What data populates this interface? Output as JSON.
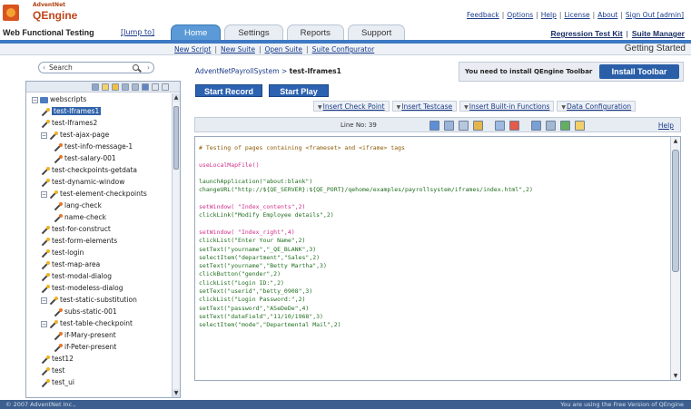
{
  "header": {
    "vendor": "AdventNet",
    "product": "QEngine",
    "app_title": "Web Functional Testing",
    "jump_to": "[Jump to]",
    "top_links": [
      "Feedback",
      "Options",
      "Help",
      "License",
      "About",
      "Sign Out [admin]"
    ],
    "right_links": [
      "Regression Test Kit",
      "Suite Manager"
    ],
    "tabs": [
      {
        "label": "Home",
        "active": true
      },
      {
        "label": "Settings",
        "active": false
      },
      {
        "label": "Reports",
        "active": false
      },
      {
        "label": "Support",
        "active": false
      }
    ]
  },
  "subnav": {
    "links": [
      "New Script",
      "New Suite",
      "Open Suite",
      "Suite Configurator"
    ],
    "getting_started": "Getting Started"
  },
  "left_panel": {
    "search_label": "Search",
    "tree": [
      {
        "label": "webscripts",
        "icon": "folder-icon",
        "expander": "−",
        "level": 0
      },
      {
        "label": "test-Iframes1",
        "icon": "wand-icon",
        "level": 1,
        "selected": true
      },
      {
        "label": "test-Iframes2",
        "icon": "wand-icon",
        "level": 1
      },
      {
        "label": "test-ajax-page",
        "icon": "wand-icon",
        "expander": "−",
        "level": 1
      },
      {
        "label": "test-info-message-1",
        "icon": "wand-icon",
        "level": 2,
        "orange": true
      },
      {
        "label": "test-salary-001",
        "icon": "wand-icon",
        "level": 2,
        "orange": true
      },
      {
        "label": "test-checkpoints-getdata",
        "icon": "wand-icon",
        "level": 1
      },
      {
        "label": "test-dynamic-window",
        "icon": "wand-icon",
        "level": 1
      },
      {
        "label": "test-element-checkpoints",
        "icon": "wand-icon",
        "expander": "−",
        "level": 1
      },
      {
        "label": "lang-check",
        "icon": "wand-icon",
        "level": 2,
        "orange": true
      },
      {
        "label": "name-check",
        "icon": "wand-icon",
        "level": 2,
        "orange": true
      },
      {
        "label": "test-for-construct",
        "icon": "wand-icon",
        "level": 1
      },
      {
        "label": "test-form-elements",
        "icon": "wand-icon",
        "level": 1
      },
      {
        "label": "test-login",
        "icon": "wand-icon",
        "level": 1
      },
      {
        "label": "test-map-area",
        "icon": "wand-icon",
        "level": 1
      },
      {
        "label": "test-modal-dialog",
        "icon": "wand-icon",
        "level": 1
      },
      {
        "label": "test-modeless-dialog",
        "icon": "wand-icon",
        "level": 1
      },
      {
        "label": "test-static-substitution",
        "icon": "wand-icon",
        "expander": "−",
        "level": 1
      },
      {
        "label": "subs-static-001",
        "icon": "wand-icon",
        "level": 2,
        "orange": true
      },
      {
        "label": "test-table-checkpoint",
        "icon": "wand-icon",
        "expander": "−",
        "level": 1
      },
      {
        "label": "if-Mary-present",
        "icon": "wand-icon",
        "level": 2,
        "orange": true
      },
      {
        "label": "if-Peter-present",
        "icon": "wand-icon",
        "level": 2,
        "orange": true
      },
      {
        "label": "test12",
        "icon": "wand-icon",
        "level": 1
      },
      {
        "label": "test",
        "icon": "wand-icon",
        "level": 1
      },
      {
        "label": "test_ui",
        "icon": "wand-icon",
        "level": 1
      }
    ]
  },
  "main": {
    "breadcrumb_root": "AdventNetPayrollSystem",
    "breadcrumb_sep": ">",
    "breadcrumb_current": "test-Iframes1",
    "notice_text": "You need to install QEngine Toolbar",
    "install_button": "Install Toolbar",
    "start_record": "Start Record",
    "start_play": "Start Play",
    "insert_actions": [
      "Insert Check Point",
      "Insert Testcase",
      "Insert Built-in Functions",
      "Data Configuration"
    ],
    "line_no_label": "Line No: 39",
    "help": "Help",
    "code_lines": [
      {
        "text": "# Testing of pages containing <frameset> and <iframe> tags",
        "cls": "c-comment"
      },
      {
        "text": "",
        "cls": ""
      },
      {
        "text": "useLocalMapFile()",
        "cls": "c-pink"
      },
      {
        "text": "",
        "cls": ""
      },
      {
        "text": "launchApplication(\"about:blank\")",
        "cls": "c-green"
      },
      {
        "text": "changeURL(\"http://${QE_SERVER}:${QE_PORT}/qehome/examples/payrollsystem/iframes/index.html\",2)",
        "cls": "c-green"
      },
      {
        "text": "",
        "cls": ""
      },
      {
        "text": "setWindow( \"Index_contents\",2)",
        "cls": "c-pink"
      },
      {
        "text": "clickLink(\"Modify Employee details\",2)",
        "cls": "c-green"
      },
      {
        "text": "",
        "cls": ""
      },
      {
        "text": "setWindow( \"Index_right\",4)",
        "cls": "c-pink"
      },
      {
        "text": "clickList(\"Enter Your Name\",2)",
        "cls": "c-green"
      },
      {
        "text": "setText(\"yourname\",\"_QE_BLANK\",3)",
        "cls": "c-green"
      },
      {
        "text": "selectItem(\"department\",\"Sales\",2)",
        "cls": "c-green"
      },
      {
        "text": "setText(\"yourname\",\"Betty Martha\",3)",
        "cls": "c-green"
      },
      {
        "text": "clickButton(\"gender\",2)",
        "cls": "c-green"
      },
      {
        "text": "clickList(\"Login ID:\",2)",
        "cls": "c-green"
      },
      {
        "text": "setText(\"userid\",\"betty_0908\",3)",
        "cls": "c-green"
      },
      {
        "text": "clickList(\"Login Password:\",2)",
        "cls": "c-green"
      },
      {
        "text": "setText(\"password\",\"ASeDeDe\",4)",
        "cls": "c-green"
      },
      {
        "text": "setText(\"dateField\",\"11/10/1968\",3)",
        "cls": "c-green"
      },
      {
        "text": "selectItem(\"mode\",\"Departmental Mail\",2)",
        "cls": "c-green"
      }
    ]
  },
  "footer": {
    "left": "© 2007 AdventNet Inc.,",
    "right": "You are using the Free Version of QEngine"
  },
  "colors": {
    "accent": "#3d79c4",
    "button": "#2c62b0",
    "selection": "#3163ab",
    "footer": "#3d5f8f"
  }
}
